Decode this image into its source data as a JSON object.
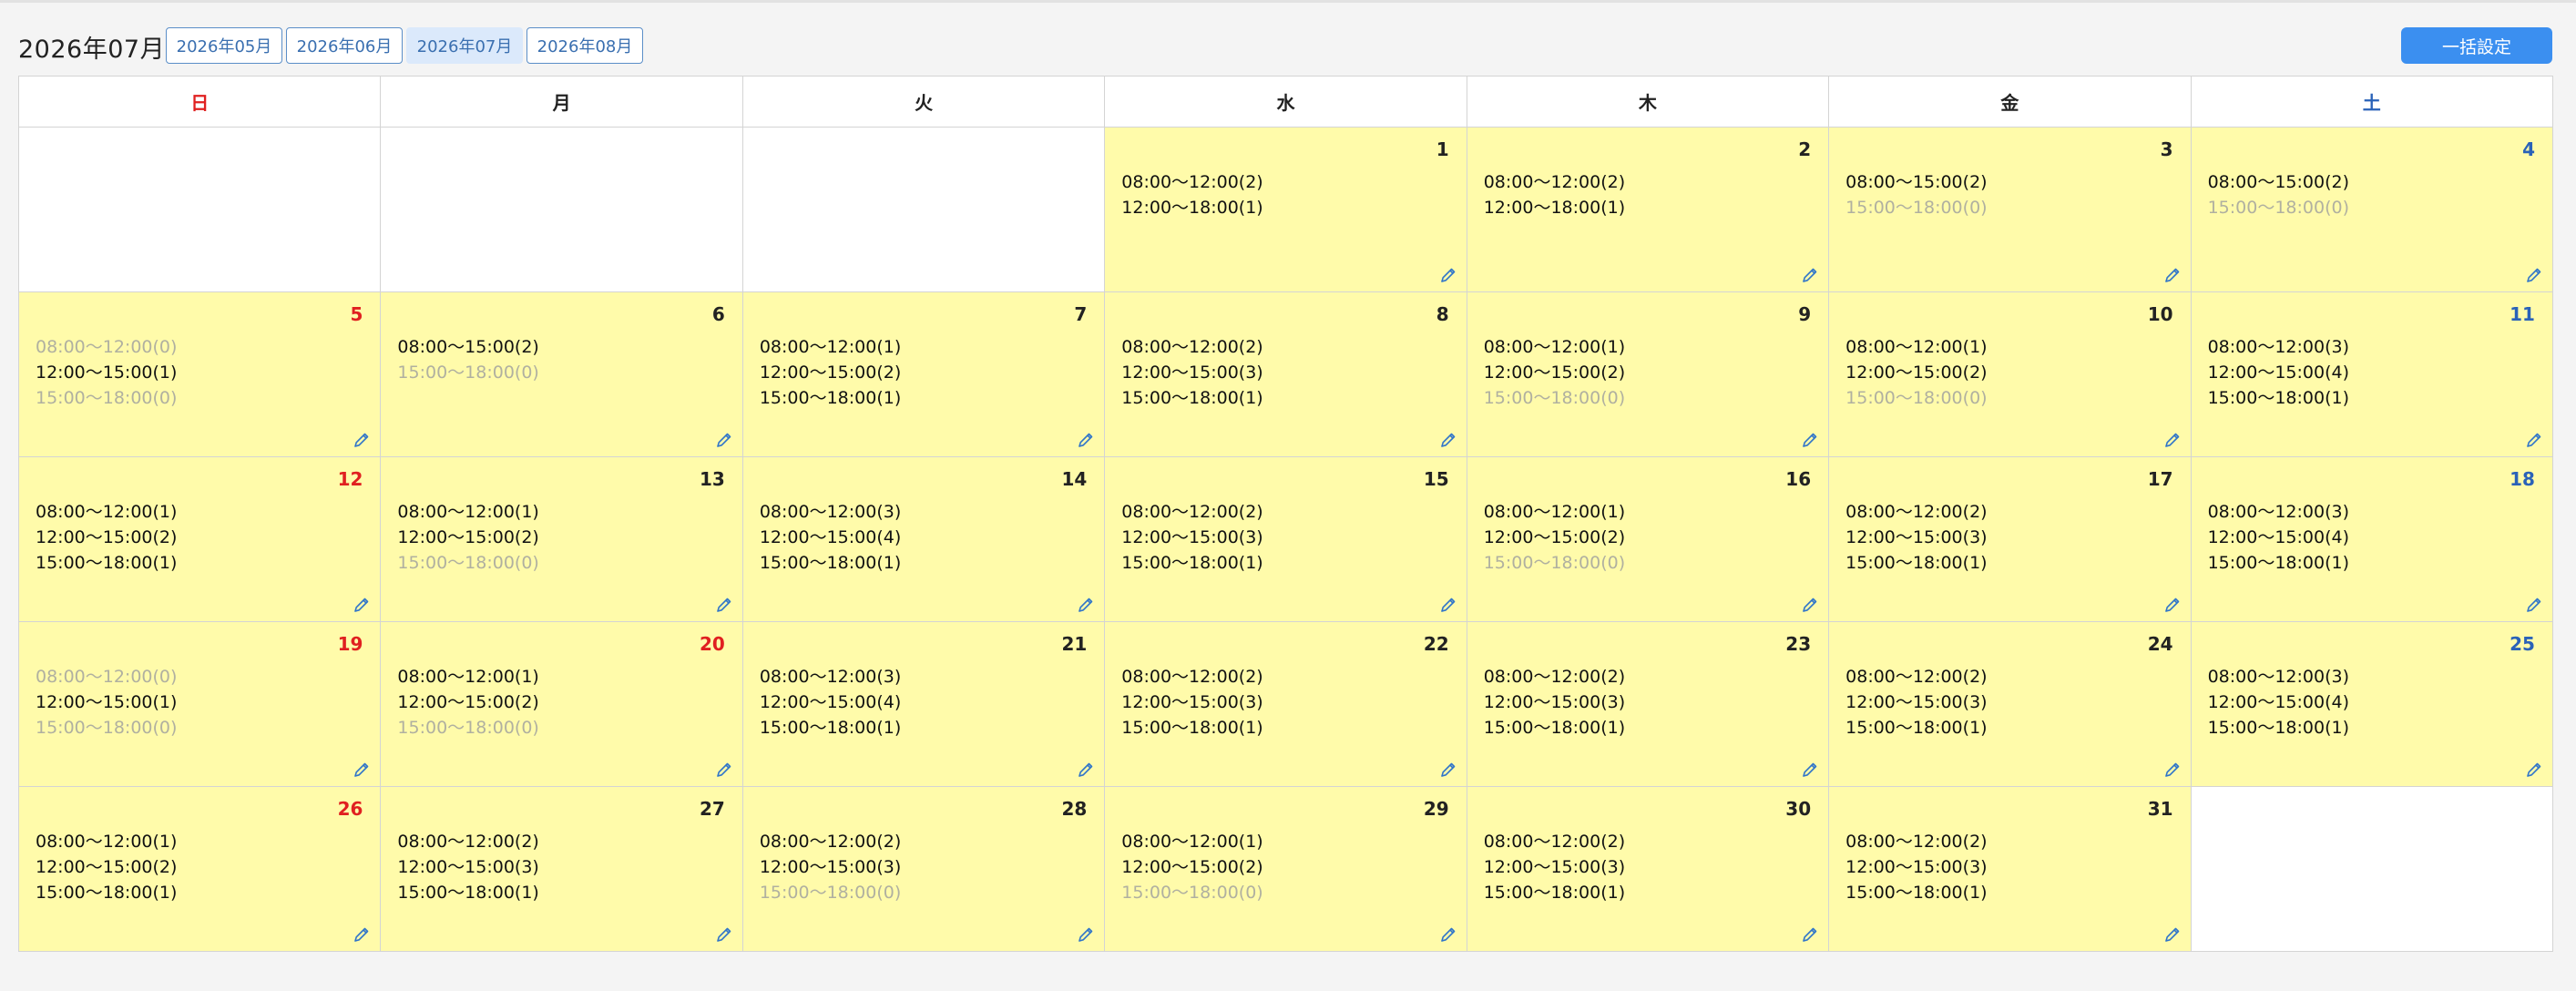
{
  "header": {
    "month_title": "2026年07月",
    "month_tabs": [
      {
        "label": "2026年05月",
        "active": false
      },
      {
        "label": "2026年06月",
        "active": false
      },
      {
        "label": "2026年07月",
        "active": true
      },
      {
        "label": "2026年08月",
        "active": false
      }
    ],
    "bulk_button": "一括設定"
  },
  "weekdays": [
    "日",
    "月",
    "火",
    "水",
    "木",
    "金",
    "土"
  ],
  "colors": {
    "sunday": "#e02020",
    "saturday": "#2a62b8",
    "available_day_bg": "#fffbaa",
    "accent": "#3b8ff0",
    "dim_slot": "#b0b0a0"
  },
  "icons": {
    "edit": "pencil-icon"
  },
  "weeks": [
    [
      null,
      null,
      null,
      {
        "day": "1",
        "slots": [
          {
            "text": "08:00〜12:00(2)",
            "dim": false
          },
          {
            "text": "12:00〜18:00(1)",
            "dim": false
          }
        ]
      },
      {
        "day": "2",
        "slots": [
          {
            "text": "08:00〜12:00(2)",
            "dim": false
          },
          {
            "text": "12:00〜18:00(1)",
            "dim": false
          }
        ]
      },
      {
        "day": "3",
        "slots": [
          {
            "text": "08:00〜15:00(2)",
            "dim": false
          },
          {
            "text": "15:00〜18:00(0)",
            "dim": true
          }
        ]
      },
      {
        "day": "4",
        "slots": [
          {
            "text": "08:00〜15:00(2)",
            "dim": false
          },
          {
            "text": "15:00〜18:00(0)",
            "dim": true
          }
        ]
      }
    ],
    [
      {
        "day": "5",
        "slots": [
          {
            "text": "08:00〜12:00(0)",
            "dim": true
          },
          {
            "text": "12:00〜15:00(1)",
            "dim": false
          },
          {
            "text": "15:00〜18:00(0)",
            "dim": true
          }
        ]
      },
      {
        "day": "6",
        "slots": [
          {
            "text": "08:00〜15:00(2)",
            "dim": false
          },
          {
            "text": "15:00〜18:00(0)",
            "dim": true
          }
        ]
      },
      {
        "day": "7",
        "slots": [
          {
            "text": "08:00〜12:00(1)",
            "dim": false
          },
          {
            "text": "12:00〜15:00(2)",
            "dim": false
          },
          {
            "text": "15:00〜18:00(1)",
            "dim": false
          }
        ]
      },
      {
        "day": "8",
        "slots": [
          {
            "text": "08:00〜12:00(2)",
            "dim": false
          },
          {
            "text": "12:00〜15:00(3)",
            "dim": false
          },
          {
            "text": "15:00〜18:00(1)",
            "dim": false
          }
        ]
      },
      {
        "day": "9",
        "slots": [
          {
            "text": "08:00〜12:00(1)",
            "dim": false
          },
          {
            "text": "12:00〜15:00(2)",
            "dim": false
          },
          {
            "text": "15:00〜18:00(0)",
            "dim": true
          }
        ]
      },
      {
        "day": "10",
        "slots": [
          {
            "text": "08:00〜12:00(1)",
            "dim": false
          },
          {
            "text": "12:00〜15:00(2)",
            "dim": false
          },
          {
            "text": "15:00〜18:00(0)",
            "dim": true
          }
        ]
      },
      {
        "day": "11",
        "slots": [
          {
            "text": "08:00〜12:00(3)",
            "dim": false
          },
          {
            "text": "12:00〜15:00(4)",
            "dim": false
          },
          {
            "text": "15:00〜18:00(1)",
            "dim": false
          }
        ]
      }
    ],
    [
      {
        "day": "12",
        "slots": [
          {
            "text": "08:00〜12:00(1)",
            "dim": false
          },
          {
            "text": "12:00〜15:00(2)",
            "dim": false
          },
          {
            "text": "15:00〜18:00(1)",
            "dim": false
          }
        ]
      },
      {
        "day": "13",
        "slots": [
          {
            "text": "08:00〜12:00(1)",
            "dim": false
          },
          {
            "text": "12:00〜15:00(2)",
            "dim": false
          },
          {
            "text": "15:00〜18:00(0)",
            "dim": true
          }
        ]
      },
      {
        "day": "14",
        "slots": [
          {
            "text": "08:00〜12:00(3)",
            "dim": false
          },
          {
            "text": "12:00〜15:00(4)",
            "dim": false
          },
          {
            "text": "15:00〜18:00(1)",
            "dim": false
          }
        ]
      },
      {
        "day": "15",
        "slots": [
          {
            "text": "08:00〜12:00(2)",
            "dim": false
          },
          {
            "text": "12:00〜15:00(3)",
            "dim": false
          },
          {
            "text": "15:00〜18:00(1)",
            "dim": false
          }
        ]
      },
      {
        "day": "16",
        "slots": [
          {
            "text": "08:00〜12:00(1)",
            "dim": false
          },
          {
            "text": "12:00〜15:00(2)",
            "dim": false
          },
          {
            "text": "15:00〜18:00(0)",
            "dim": true
          }
        ]
      },
      {
        "day": "17",
        "slots": [
          {
            "text": "08:00〜12:00(2)",
            "dim": false
          },
          {
            "text": "12:00〜15:00(3)",
            "dim": false
          },
          {
            "text": "15:00〜18:00(1)",
            "dim": false
          }
        ]
      },
      {
        "day": "18",
        "slots": [
          {
            "text": "08:00〜12:00(3)",
            "dim": false
          },
          {
            "text": "12:00〜15:00(4)",
            "dim": false
          },
          {
            "text": "15:00〜18:00(1)",
            "dim": false
          }
        ]
      }
    ],
    [
      {
        "day": "19",
        "slots": [
          {
            "text": "08:00〜12:00(0)",
            "dim": true
          },
          {
            "text": "12:00〜15:00(1)",
            "dim": false
          },
          {
            "text": "15:00〜18:00(0)",
            "dim": true
          }
        ]
      },
      {
        "day": "20",
        "holiday": true,
        "slots": [
          {
            "text": "08:00〜12:00(1)",
            "dim": false
          },
          {
            "text": "12:00〜15:00(2)",
            "dim": false
          },
          {
            "text": "15:00〜18:00(0)",
            "dim": true
          }
        ]
      },
      {
        "day": "21",
        "slots": [
          {
            "text": "08:00〜12:00(3)",
            "dim": false
          },
          {
            "text": "12:00〜15:00(4)",
            "dim": false
          },
          {
            "text": "15:00〜18:00(1)",
            "dim": false
          }
        ]
      },
      {
        "day": "22",
        "slots": [
          {
            "text": "08:00〜12:00(2)",
            "dim": false
          },
          {
            "text": "12:00〜15:00(3)",
            "dim": false
          },
          {
            "text": "15:00〜18:00(1)",
            "dim": false
          }
        ]
      },
      {
        "day": "23",
        "slots": [
          {
            "text": "08:00〜12:00(2)",
            "dim": false
          },
          {
            "text": "12:00〜15:00(3)",
            "dim": false
          },
          {
            "text": "15:00〜18:00(1)",
            "dim": false
          }
        ]
      },
      {
        "day": "24",
        "slots": [
          {
            "text": "08:00〜12:00(2)",
            "dim": false
          },
          {
            "text": "12:00〜15:00(3)",
            "dim": false
          },
          {
            "text": "15:00〜18:00(1)",
            "dim": false
          }
        ]
      },
      {
        "day": "25",
        "slots": [
          {
            "text": "08:00〜12:00(3)",
            "dim": false
          },
          {
            "text": "12:00〜15:00(4)",
            "dim": false
          },
          {
            "text": "15:00〜18:00(1)",
            "dim": false
          }
        ]
      }
    ],
    [
      {
        "day": "26",
        "slots": [
          {
            "text": "08:00〜12:00(1)",
            "dim": false
          },
          {
            "text": "12:00〜15:00(2)",
            "dim": false
          },
          {
            "text": "15:00〜18:00(1)",
            "dim": false
          }
        ]
      },
      {
        "day": "27",
        "slots": [
          {
            "text": "08:00〜12:00(2)",
            "dim": false
          },
          {
            "text": "12:00〜15:00(3)",
            "dim": false
          },
          {
            "text": "15:00〜18:00(1)",
            "dim": false
          }
        ]
      },
      {
        "day": "28",
        "slots": [
          {
            "text": "08:00〜12:00(2)",
            "dim": false
          },
          {
            "text": "12:00〜15:00(3)",
            "dim": false
          },
          {
            "text": "15:00〜18:00(0)",
            "dim": true
          }
        ]
      },
      {
        "day": "29",
        "slots": [
          {
            "text": "08:00〜12:00(1)",
            "dim": false
          },
          {
            "text": "12:00〜15:00(2)",
            "dim": false
          },
          {
            "text": "15:00〜18:00(0)",
            "dim": true
          }
        ]
      },
      {
        "day": "30",
        "slots": [
          {
            "text": "08:00〜12:00(2)",
            "dim": false
          },
          {
            "text": "12:00〜15:00(3)",
            "dim": false
          },
          {
            "text": "15:00〜18:00(1)",
            "dim": false
          }
        ]
      },
      {
        "day": "31",
        "slots": [
          {
            "text": "08:00〜12:00(2)",
            "dim": false
          },
          {
            "text": "12:00〜15:00(3)",
            "dim": false
          },
          {
            "text": "15:00〜18:00(1)",
            "dim": false
          }
        ]
      },
      null
    ]
  ]
}
